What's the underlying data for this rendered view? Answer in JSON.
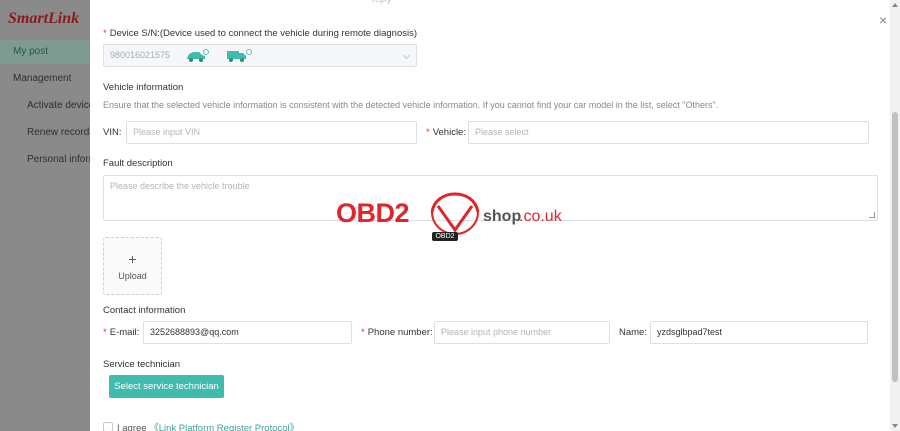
{
  "sidebar": {
    "logo": "SmartLink",
    "items": [
      {
        "label": "My post"
      },
      {
        "label": "Management"
      },
      {
        "label": "Activate device"
      },
      {
        "label": "Renew records"
      },
      {
        "label": "Personal information"
      }
    ]
  },
  "modal": {
    "reply_text": "reply",
    "device": {
      "label": "Device S/N:(Device used to connect the vehicle during remote diagnosis)",
      "value": "980016021575"
    },
    "vehicle_info": {
      "title": "Vehicle information",
      "hint": "Ensure that the selected vehicle information is consistent with the detected vehicle information. If you cannot find your car model in the list, select \"Others\".",
      "vin_label": "VIN:",
      "vin_placeholder": "Please input VIN",
      "vehicle_label": "Vehicle:",
      "vehicle_placeholder": "Please select"
    },
    "fault": {
      "title": "Fault description",
      "placeholder": "Please describe the vehicle trouble"
    },
    "upload": {
      "plus": "+",
      "label": "Upload"
    },
    "contact": {
      "title": "Contact information",
      "email_label": "E-mail:",
      "email_value": "3252688893@qq.com",
      "phone_label": "Phone number:",
      "phone_placeholder": "Please input phone number",
      "name_label": "Name:",
      "name_value": "yzdsglbpad7test"
    },
    "technician": {
      "title": "Service technician",
      "button": "Select service technician"
    },
    "agree": {
      "text": "I agree",
      "link": "《Link Platform Register Protocol》"
    },
    "close": "×"
  },
  "watermark": {
    "obd": "OBD2",
    "shop": "shop",
    "domain": ".co.uk",
    "badge": "OBD2"
  },
  "colors": {
    "accent": "#3fbcad",
    "required": "#ee3333",
    "watermark_red": "#e0262b"
  }
}
